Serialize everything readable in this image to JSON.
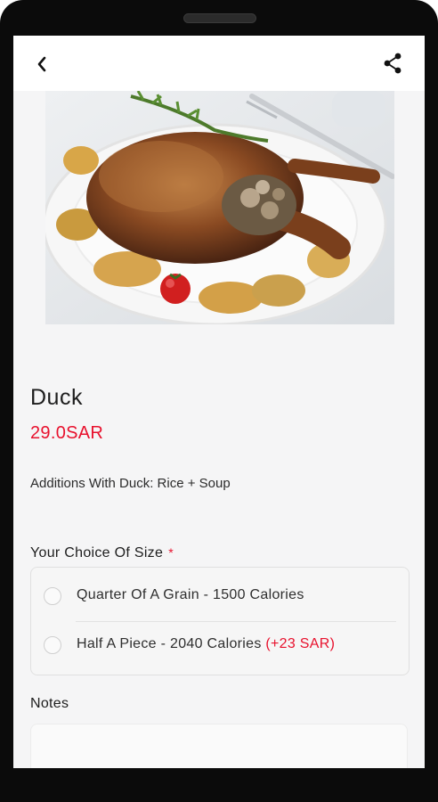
{
  "header": {
    "back_icon": "chevron-left-icon",
    "share_icon": "share-icon"
  },
  "product": {
    "image_alt": "roast-duck-photo",
    "name": "Duck",
    "price": "29.0SAR",
    "description": "Additions With Duck: Rice + Soup"
  },
  "size_section": {
    "label": "Your Choice Of Size",
    "required_mark": "*",
    "options": [
      {
        "label": "Quarter Of A Grain - 1500 Calories",
        "extra": ""
      },
      {
        "label": "Half A Piece - 2040 Calories",
        "extra": "(+23 SAR)"
      }
    ]
  },
  "notes": {
    "label": "Notes",
    "placeholder": ""
  },
  "colors": {
    "accent": "#e8112d",
    "text": "#1d1d1d",
    "background": "#f5f5f6"
  }
}
